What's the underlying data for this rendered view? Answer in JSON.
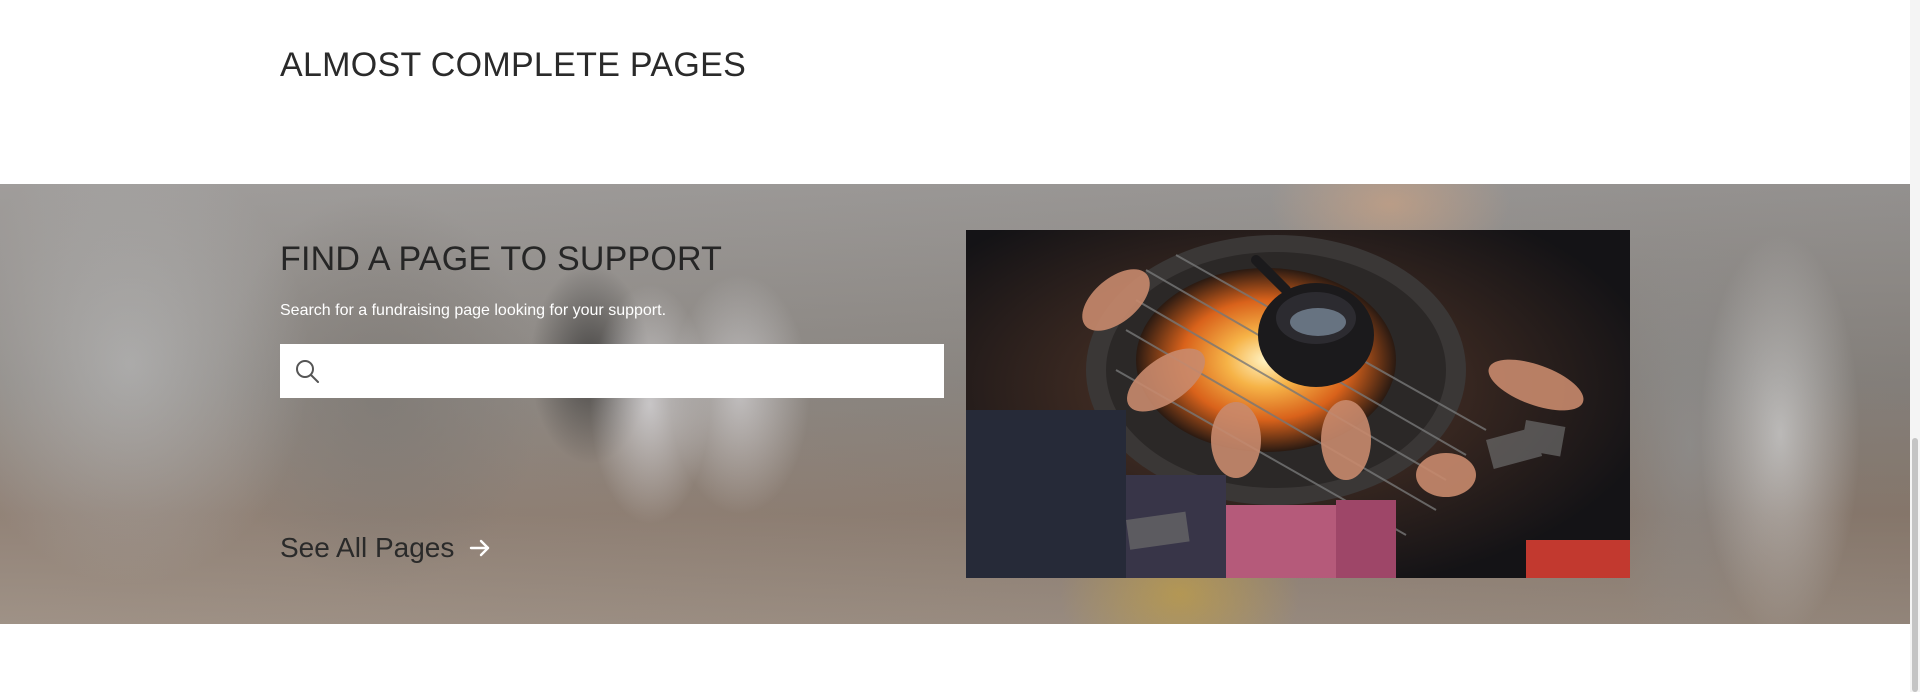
{
  "section": {
    "title": "ALMOST COMPLETE PAGES"
  },
  "hero": {
    "heading": "FIND A PAGE TO SUPPORT",
    "subtext": "Search for a fundraising page looking for your support.",
    "search": {
      "value": "",
      "placeholder": "",
      "icon": "search-icon"
    },
    "see_all_label": "See All Pages",
    "see_all_icon": "arrow-right-icon"
  },
  "colors": {
    "heading": "#262626",
    "subtext": "#ffffff",
    "search_background": "#ffffff",
    "fire": "#f29a2e"
  }
}
